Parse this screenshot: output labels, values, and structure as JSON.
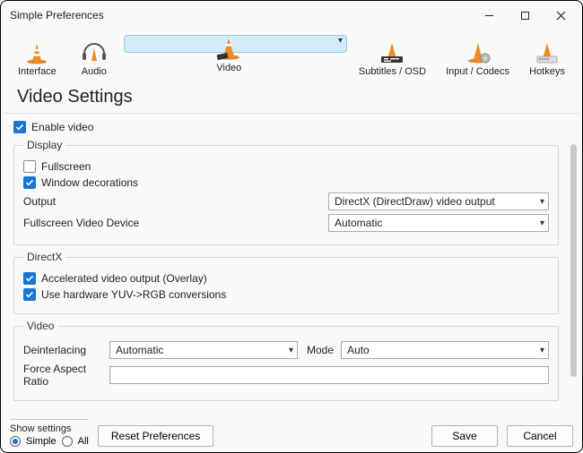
{
  "window": {
    "title": "Simple Preferences"
  },
  "tabs": [
    {
      "label": "Interface"
    },
    {
      "label": "Audio"
    },
    {
      "label": "Video"
    },
    {
      "label": "Subtitles / OSD"
    },
    {
      "label": "Input / Codecs"
    },
    {
      "label": "Hotkeys"
    }
  ],
  "page": {
    "heading": "Video Settings"
  },
  "main": {
    "enable_video": "Enable video",
    "display": {
      "legend": "Display",
      "fullscreen": "Fullscreen",
      "window_decorations": "Window decorations",
      "output_label": "Output",
      "output_value": "DirectX (DirectDraw) video output",
      "fs_device_label": "Fullscreen Video Device",
      "fs_device_value": "Automatic"
    },
    "directx": {
      "legend": "DirectX",
      "accel": "Accelerated video output (Overlay)",
      "yuv": "Use hardware YUV->RGB conversions"
    },
    "video": {
      "legend": "Video",
      "deint_label": "Deinterlacing",
      "deint_value": "Automatic",
      "mode_label": "Mode",
      "mode_value": "Auto",
      "force_ar_label": "Force Aspect Ratio",
      "force_ar_value": ""
    }
  },
  "footer": {
    "show_settings": "Show settings",
    "simple": "Simple",
    "all": "All",
    "reset": "Reset Preferences",
    "save": "Save",
    "cancel": "Cancel"
  }
}
